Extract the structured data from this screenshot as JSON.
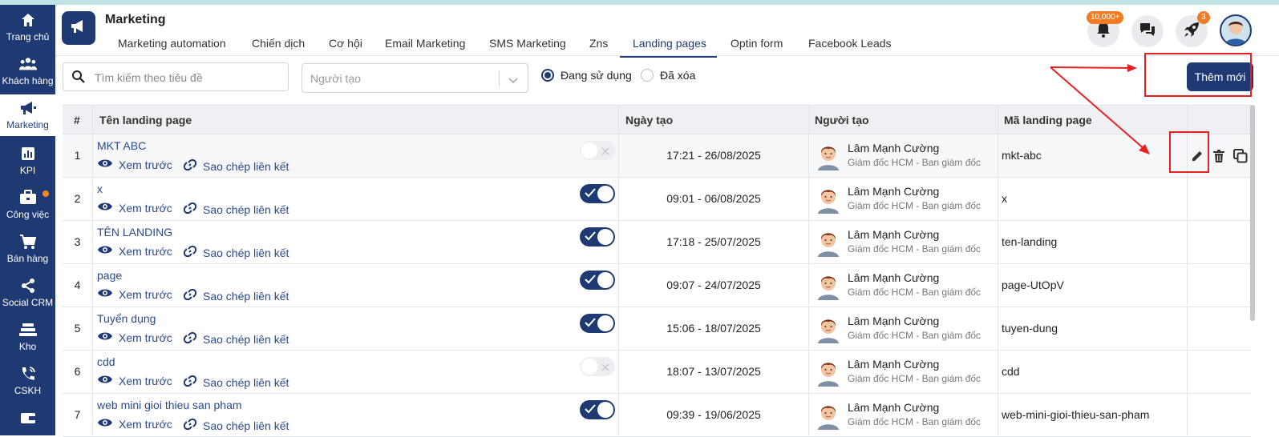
{
  "sidebar": {
    "items": [
      {
        "label": "Trang chủ",
        "icon": "home-icon"
      },
      {
        "label": "Khách hàng",
        "icon": "users-icon"
      },
      {
        "label": "Marketing",
        "icon": "megaphone-icon",
        "active": true
      },
      {
        "label": "KPI",
        "icon": "chart-icon"
      },
      {
        "label": "Công việc",
        "icon": "briefcase-icon"
      },
      {
        "label": "Bán hàng",
        "icon": "cart-icon"
      },
      {
        "label": "Social CRM",
        "icon": "share-icon"
      },
      {
        "label": "Kho",
        "icon": "warehouse-icon"
      },
      {
        "label": "CSKH",
        "icon": "phone-icon"
      }
    ]
  },
  "header": {
    "title": "Marketing",
    "tabs": [
      {
        "label": "Marketing automation"
      },
      {
        "label": "Chiến dịch"
      },
      {
        "label": "Cơ hội"
      },
      {
        "label": "Email Marketing"
      },
      {
        "label": "SMS Marketing"
      },
      {
        "label": "Zns"
      },
      {
        "label": "Landing pages",
        "active": true
      },
      {
        "label": "Optin form"
      },
      {
        "label": "Facebook Leads"
      }
    ],
    "notification_badge": "10,000+",
    "rocket_badge": "3"
  },
  "toolbar": {
    "search_placeholder": "Tìm kiếm theo tiêu đề",
    "creator_placeholder": "Người tạo",
    "radio_active": "Đang sử dụng",
    "radio_deleted": "Đã xóa",
    "add_label": "Thêm mới"
  },
  "table": {
    "headers": {
      "index": "#",
      "name": "Tên landing page",
      "date": "Ngày tạo",
      "creator": "Người tạo",
      "code": "Mã landing page"
    },
    "preview_label": "Xem trước",
    "copy_label": "Sao chép liên kết",
    "rows": [
      {
        "index": "1",
        "name": "MKT ABC",
        "active": false,
        "date": "17:21 - 26/08/2025",
        "creator": "Lâm Mạnh Cường",
        "role": "Giám đốc HCM - Ban giám đốc",
        "code": "mkt-abc"
      },
      {
        "index": "2",
        "name": "x",
        "active": true,
        "date": "09:01 - 06/08/2025",
        "creator": "Lâm Mạnh Cường",
        "role": "Giám đốc HCM - Ban giám đốc",
        "code": "x"
      },
      {
        "index": "3",
        "name": "TÊN LANDING",
        "active": true,
        "date": "17:18 - 25/07/2025",
        "creator": "Lâm Mạnh Cường",
        "role": "Giám đốc HCM - Ban giám đốc",
        "code": "ten-landing"
      },
      {
        "index": "4",
        "name": "page",
        "active": true,
        "date": "09:07 - 24/07/2025",
        "creator": "Lâm Mạnh Cường",
        "role": "Giám đốc HCM - Ban giám đốc",
        "code": "page-UtOpV"
      },
      {
        "index": "5",
        "name": "Tuyển dụng",
        "active": true,
        "date": "15:06 - 18/07/2025",
        "creator": "Lâm Mạnh Cường",
        "role": "Giám đốc HCM - Ban giám đốc",
        "code": "tuyen-dung"
      },
      {
        "index": "6",
        "name": "cdd",
        "active": false,
        "date": "18:07 - 13/07/2025",
        "creator": "Lâm Mạnh Cường",
        "role": "Giám đốc HCM - Ban giám đốc",
        "code": "cdd"
      },
      {
        "index": "7",
        "name": "web mini gioi thieu san pham",
        "active": true,
        "date": "09:39 - 19/06/2025",
        "creator": "Lâm Mạnh Cường",
        "role": "Giám đốc HCM - Ban giám đốc",
        "code": "web-mini-gioi-thieu-san-pham"
      }
    ]
  },
  "colors": {
    "primary": "#1f3a73",
    "accent": "#f07c24",
    "annotation": "#e82020"
  }
}
